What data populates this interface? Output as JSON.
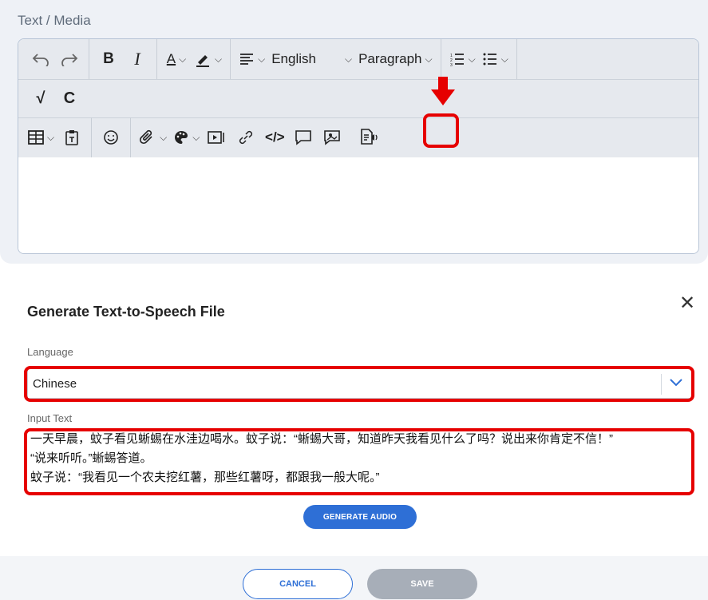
{
  "editor": {
    "field_label": "Text / Media",
    "toolbar": {
      "language_label": "English",
      "paragraph_label": "Paragraph"
    }
  },
  "dialog": {
    "title": "Generate Text-to-Speech File",
    "language_label": "Language",
    "language_value": "Chinese",
    "input_label": "Input Text",
    "input_lines": [
      "一天早晨，蚊子看见蜥蜴在水洼边喝水。蚊子说：“蜥蜴大哥，知道昨天我看见什么了吗？说出来你肯定不信！”",
      "“说来听听。”蜥蜴答道。",
      "蚊子说：“我看见一个农夫挖红薯，那些红薯呀，都跟我一般大呢。”"
    ],
    "generate_label": "GENERATE AUDIO",
    "cancel_label": "CANCEL",
    "save_label": "SAVE"
  },
  "colors": {
    "accent": "#2e6fd6",
    "highlight": "#e60000",
    "disabled": "#a7aeb8"
  }
}
